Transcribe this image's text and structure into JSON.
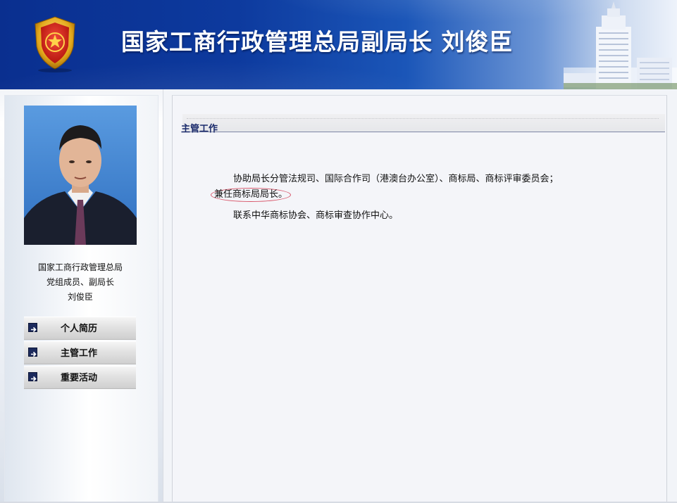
{
  "header": {
    "title": "国家工商行政管理总局副局长  刘俊臣",
    "colors": {
      "banner_dark": "#0a2f8f",
      "banner_light": "#eef3fb"
    }
  },
  "sidebar": {
    "bio": [
      "国家工商行政管理总局",
      "党组成员、副局长",
      "刘俊臣"
    ],
    "nav": [
      {
        "label": "个人简历",
        "icon": "arrow-right-icon"
      },
      {
        "label": "主管工作",
        "icon": "arrow-right-icon"
      },
      {
        "label": "重要活动",
        "icon": "arrow-right-icon"
      }
    ]
  },
  "main": {
    "tab_title": "主管工作",
    "paragraphs": {
      "p1_line1": "协助局长分管法规司、国际合作司（港澳台办公室）、商标局、商标评审委员会；",
      "p1_line2": "兼任商标局局长。",
      "p2": "联系中华商标协会、商标审查协作中心。"
    },
    "colors": {
      "tab_title": "#1a2a6b",
      "highlight_ring": "#d8566a"
    }
  }
}
